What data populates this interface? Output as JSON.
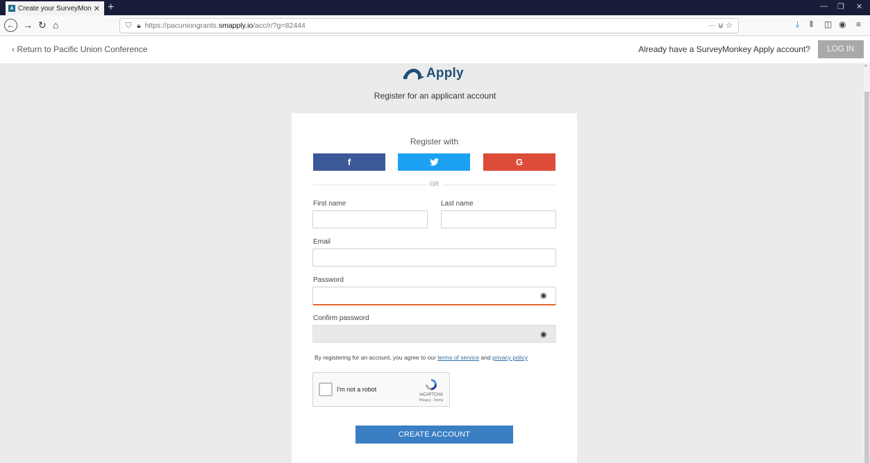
{
  "browser": {
    "tab_title": "Create your SurveyMonkey Ap",
    "tab_close": "✕",
    "new_tab": "+",
    "url_prefix": "https://pacuniongrants.",
    "url_host": "smapply.io",
    "url_path": "/acc/r/?g=82444",
    "url_actions": "··· ⊍ ☆",
    "min": "—",
    "restore": "❐",
    "close": "✕"
  },
  "header": {
    "return_link": "Return to Pacific Union Conference",
    "already_text": "Already have a SurveyMonkey Apply account?",
    "login_label": "LOG IN"
  },
  "logo": {
    "text": "Apply"
  },
  "subtitle": "Register for an applicant account",
  "form": {
    "register_with": "Register with",
    "facebook_glyph": "f",
    "twitter_glyph": "🐦",
    "google_glyph": "G",
    "or_text": "OR",
    "first_name_label": "First name",
    "last_name_label": "Last name",
    "email_label": "Email",
    "password_label": "Password",
    "confirm_password_label": "Confirm password",
    "terms_prefix": "By registering for an account, you agree to our ",
    "terms_link": "terms of service",
    "terms_and": " and ",
    "privacy_link": "privacy policy",
    "captcha_label": "I'm not a robot",
    "captcha_brand": "reCAPTCHA",
    "captcha_sub": "Privacy - Terms",
    "submit_label": "CREATE ACCOUNT"
  },
  "colors": {
    "facebook": "#3b5998",
    "twitter": "#1da1f2",
    "google": "#dd4b39",
    "primary_button": "#3a7ec4",
    "focus_underline": "#e4642d"
  }
}
